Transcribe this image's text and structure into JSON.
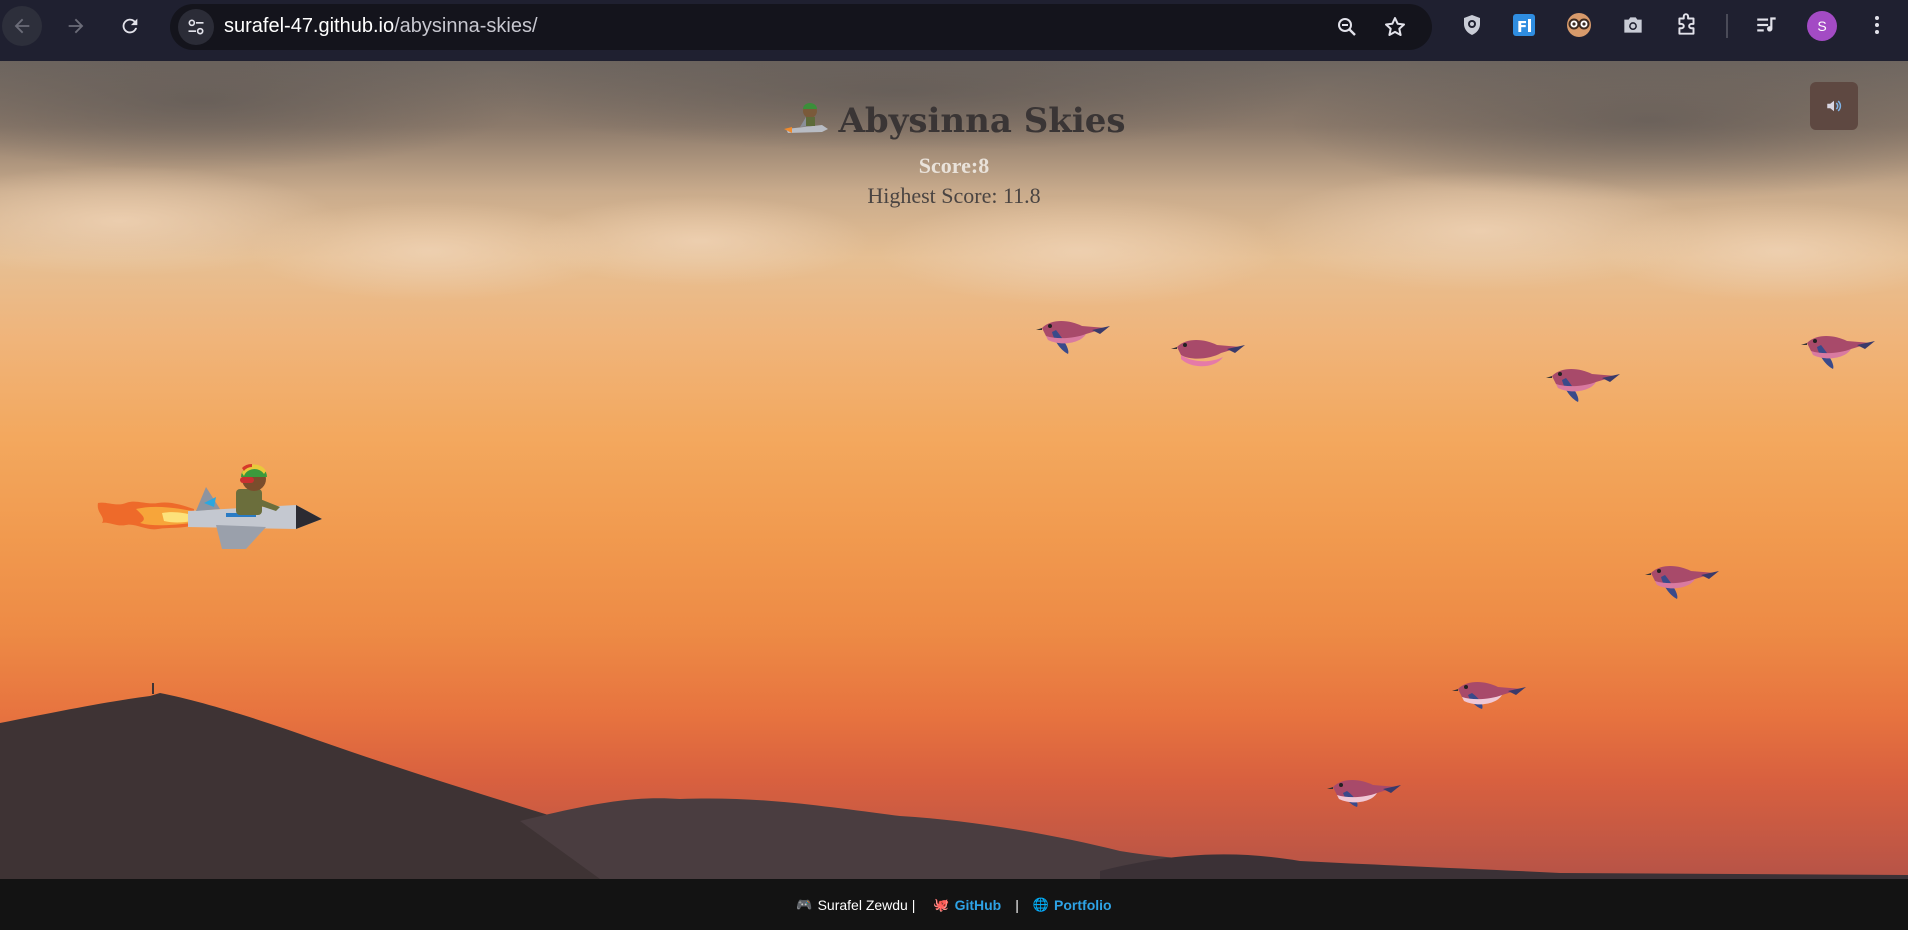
{
  "browser": {
    "url_host": "surafel-47.github.io",
    "url_path": "/abysinna-skies/",
    "avatar_letter": "S",
    "icons": [
      "back-icon",
      "forward-icon",
      "reload-icon",
      "site-settings-icon",
      "zoom-icon",
      "bookmark-star-icon",
      "shield-extension-icon",
      "translate-extension-icon",
      "glasses-extension-icon",
      "camera-extension-icon",
      "extensions-puzzle-icon",
      "media-controls-icon",
      "more-menu-icon"
    ]
  },
  "game": {
    "title": "Abysinna Skies",
    "score_label": "Score:",
    "score_value": "8",
    "highscore_label": "Highest Score:",
    "highscore_value": "11.8",
    "sound_icon": "🔊",
    "bird_count": 7
  },
  "footer": {
    "author_icon": "🎮",
    "author": "Surafel Zewdu |",
    "github_icon": "🐙",
    "github_label": "GitHub",
    "separator": "|",
    "portfolio_icon": "🌐",
    "portfolio_label": "Portfolio"
  },
  "colors": {
    "chrome_bg": "#1f2030",
    "sky_top": "#6e6660",
    "sky_bottom": "#d8603f",
    "link": "#2ea3e6",
    "footer_bg": "#131313"
  }
}
